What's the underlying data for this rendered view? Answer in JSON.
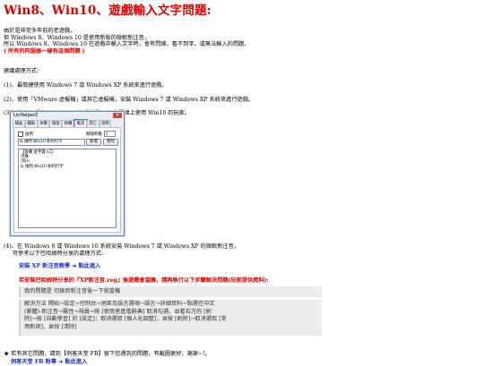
{
  "title": "Win8、Win10、遊戲輸入文字問題:",
  "intro": [
    "由於是非常多年前的老遊戲，",
    "但 Windows 8、Windows 10 是使用新版的微軟新注音，",
    "所以 Windows 8、Windows 10 在遊戲中輸入文字時，會有閃爍、看不到字、或無法輸入的問題。"
  ],
  "intro_red": "( 所有的同服器一樣有這個問題 )",
  "advice_head": "建議處理方式:",
  "steps": [
    "(1)、最簡建使用 Windows 7 或 Windows XP 系統來進行遊戲。",
    "(2)、使用「VMware 虛擬機」或其它虛擬機，安裝 Windows 7 或 Windows XP 系統來進行遊戲。",
    "(3)、先使用「LinHelperZ」的「萬語」，來與開緣上使用 Win10 的玩家。"
  ],
  "window": {
    "title": "LinHelperZ",
    "close": "✕",
    "tabs": [
      "補血",
      "輔助",
      "攻擊",
      "施放",
      "掛機",
      "萬語",
      "其它",
      "說明"
    ],
    "active_tab": "萬語",
    "enable_label": "啟用",
    "interval_label": "間隔秒數",
    "interval_value": "5",
    "combo_value": "& 請問 Win10 如何打字",
    "add_button": "新增",
    "remove_button": "移除",
    "list_items": [
      "【收購 星宇貨入口",
      "次購",
      "/加入",
      "& 請問 Win10 如何打字"
    ]
  },
  "step4_line1": "(4)、在 Windows 8 或 Windows 10 系統安裝 Windows 7 或 Windows XP 的微軟新注音，",
  "step4_line2": "可參考以下巴哈姆特分享的處理方式:",
  "link_text": "安裝 XP 新注音教學 ➜ 點此進入",
  "red_note": "若安裝巴哈姆特分享的『XP新注音.reg』後遊戲會當機，請再執行以下步驟解決問題(玩家提供資料):",
  "quote1": "我的問題是 切換到新注音後一下就當機",
  "quote2": [
    "解決方法 開始→設定→控制台→地區及語言選項→語言→詳細資料→點選在中文",
    "(繁體)-新注音→屬性→視員→將 [使用者進階辭典] 取消勾選，並看右方的 [刷",
    "除]→按 [自動學習] 的 [設定]：取消選取 [個人化調整]，並按 [刷除]→取消選取 [常",
    "用新詞]，並按 [清除]"
  ],
  "footer_note": "★ 若有其它問題，請到【例客天堂 FB】留下您遇到的問題，有截圖更好，謝謝~!。",
  "footer_link": "例客天堂 FB 粉專 ➜ 點此進入"
}
